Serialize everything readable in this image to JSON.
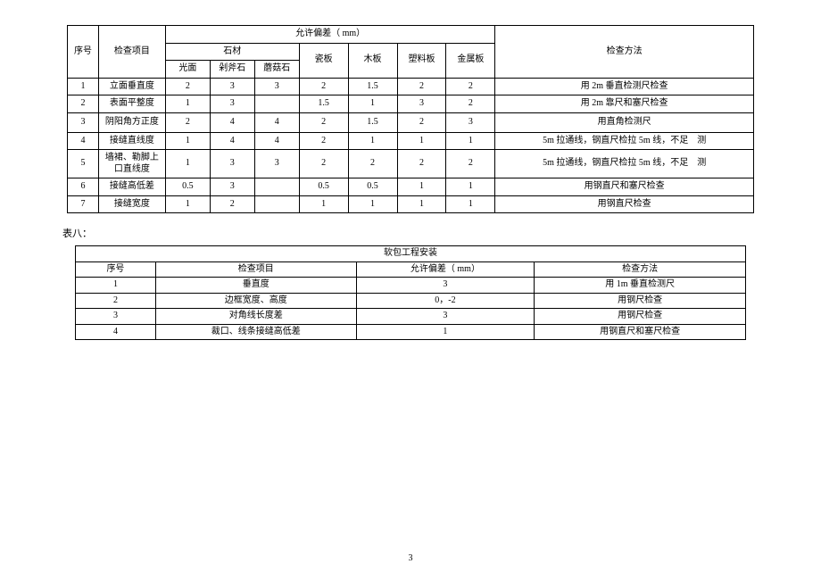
{
  "table1": {
    "group_header": "允许偏差（ mm）",
    "header_seq": "序号",
    "header_item": "检查项目",
    "header_method": "检查方法",
    "sub_stone": "石材",
    "sub_tile": "瓷板",
    "sub_wood": "木板",
    "sub_plastic": "塑料板",
    "sub_metal": "金属板",
    "sub_glossy": "光面",
    "sub_chisel": "剁斧石",
    "sub_mushroom": "蘑菇石",
    "rows": [
      {
        "n": "1",
        "item": "立面垂直度",
        "c1": "2",
        "c2": "3",
        "c3": "3",
        "c4": "2",
        "c5": "1.5",
        "c6": "2",
        "c7": "2",
        "m": "用 2m 垂直检测尺检查"
      },
      {
        "n": "2",
        "item": "表面平整度",
        "c1": "1",
        "c2": "3",
        "c3": "",
        "c4": "1.5",
        "c5": "1",
        "c6": "3",
        "c7": "2",
        "m": "用 2m 靠尺和塞尺检查"
      },
      {
        "n": "3",
        "item": "阴阳角方正度",
        "c1": "2",
        "c2": "4",
        "c3": "4",
        "c4": "2",
        "c5": "1.5",
        "c6": "2",
        "c7": "3",
        "m": "用直角检测尺"
      },
      {
        "n": "4",
        "item": "接缝直线度",
        "c1": "1",
        "c2": "4",
        "c3": "4",
        "c4": "2",
        "c5": "1",
        "c6": "1",
        "c7": "1",
        "m": "5m 拉通线，钢直尺检拉 5m 线，不足　测"
      },
      {
        "n": "5",
        "item": "墙裙、勒脚上口直线度",
        "c1": "1",
        "c2": "3",
        "c3": "3",
        "c4": "2",
        "c5": "2",
        "c6": "2",
        "c7": "2",
        "m": "5m 拉通线，钢直尺检拉 5m 线，不足　测"
      },
      {
        "n": "6",
        "item": "接缝高低差",
        "c1": "0.5",
        "c2": "3",
        "c3": "",
        "c4": "0.5",
        "c5": "0.5",
        "c6": "1",
        "c7": "1",
        "m": "用钢直尺和塞尺检查"
      },
      {
        "n": "7",
        "item": "接缝宽度",
        "c1": "1",
        "c2": "2",
        "c3": "",
        "c4": "1",
        "c5": "1",
        "c6": "1",
        "c7": "1",
        "m": "用钢直尺检查"
      }
    ]
  },
  "label8": "表八：",
  "table2": {
    "caption": "软包工程安装",
    "h_seq": "序号",
    "h_item": "检查项目",
    "h_dev": "允许偏差（ mm）",
    "h_method": "检查方法",
    "rows": [
      {
        "n": "1",
        "item": "垂直度",
        "dev": "3",
        "m": "用 1m 垂直检测尺"
      },
      {
        "n": "2",
        "item": "边框宽度、高度",
        "dev": "0，-2",
        "m": "用钢尺检查"
      },
      {
        "n": "3",
        "item": "对角线长度差",
        "dev": "3",
        "m": "用钢尺检查"
      },
      {
        "n": "4",
        "item": "裁口、线条接缝高低差",
        "dev": "1",
        "m": "用钢直尺和塞尺检查"
      }
    ]
  },
  "pagenum": "3"
}
